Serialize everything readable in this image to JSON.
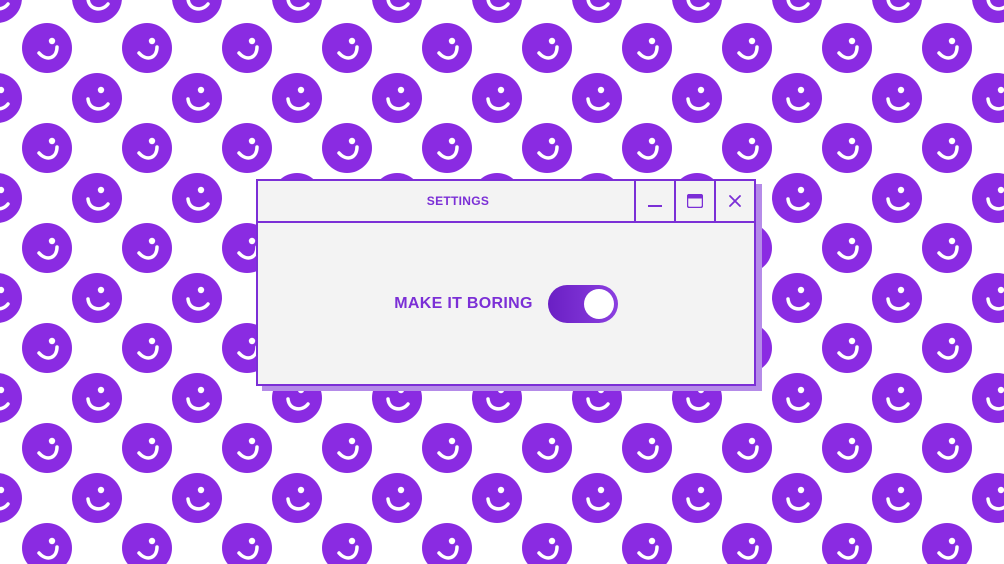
{
  "window": {
    "title": "SETTINGS"
  },
  "setting": {
    "label": "MAKE IT BORING",
    "enabled": true
  },
  "icons": {
    "background": "smiley-face-icon",
    "minimize": "minimize-icon",
    "maximize": "maximize-icon",
    "close": "close-icon"
  },
  "colors": {
    "accent": "#7b2fd6",
    "window_bg": "#f3f3f3",
    "shadow": "#b58be8",
    "toggle": "#7a2fd6",
    "background": "#ffffff"
  }
}
